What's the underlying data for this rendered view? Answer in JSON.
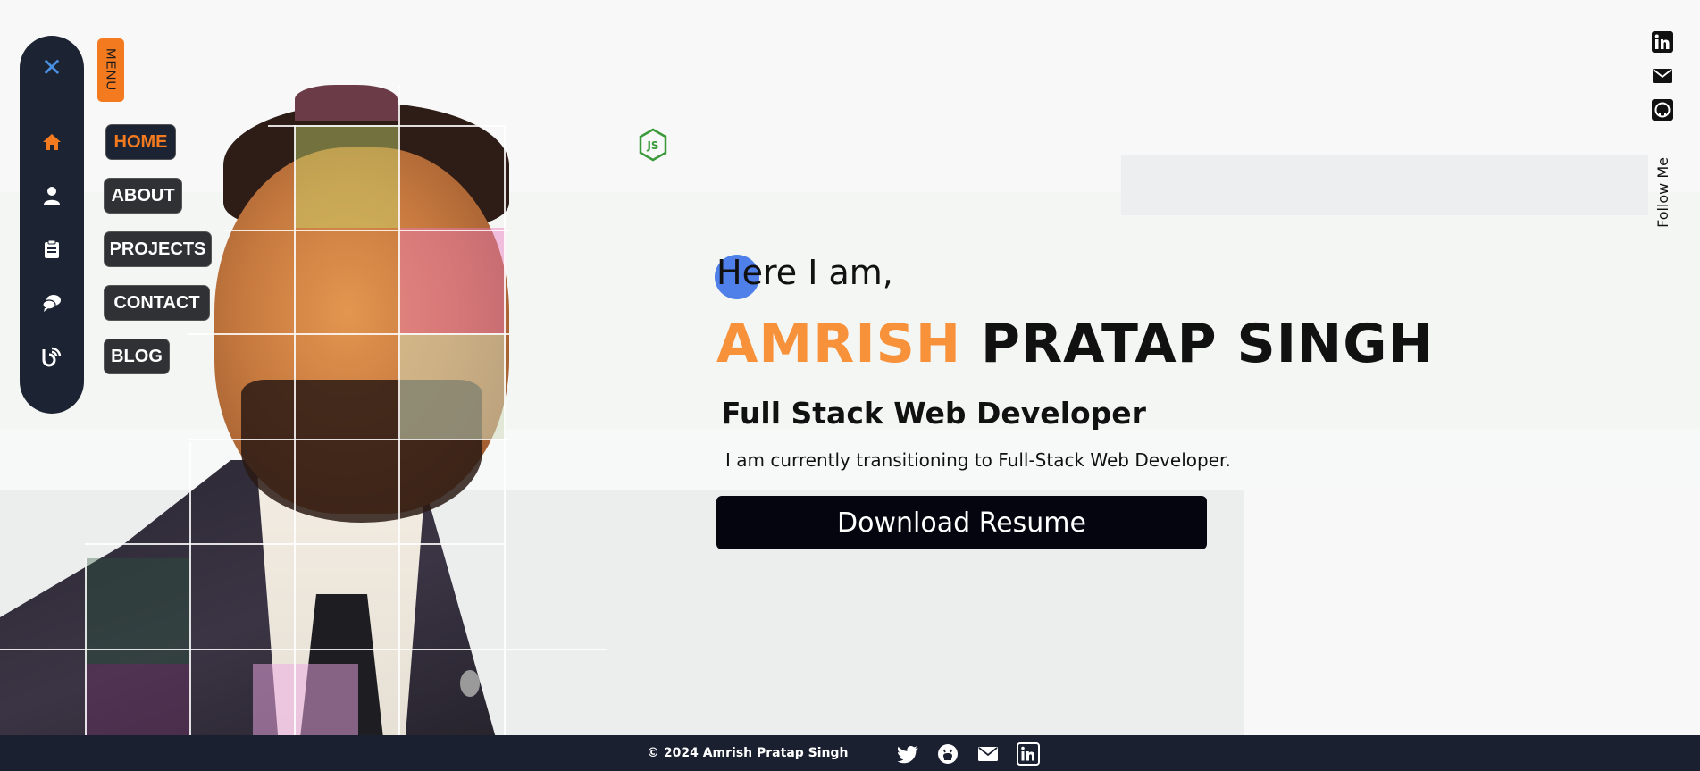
{
  "menu": {
    "close_icon": "close-icon",
    "tab_label": "MENU",
    "items": [
      {
        "label": "HOME",
        "icon": "home-icon",
        "active": true
      },
      {
        "label": "ABOUT",
        "icon": "user-icon",
        "active": false
      },
      {
        "label": "PROJECTS",
        "icon": "clipboard-icon",
        "active": false
      },
      {
        "label": "CONTACT",
        "icon": "chat-icon",
        "active": false
      },
      {
        "label": "BLOG",
        "icon": "blogger-icon",
        "active": false
      }
    ]
  },
  "hero": {
    "greeting": "Here I am,",
    "first_name": "AMRISH",
    "last_name": "PRATAP SINGH",
    "role": "Full Stack Web Developer",
    "tagline": "I am currently transitioning to Full-Stack Web Developer.",
    "cta_label": "Download Resume"
  },
  "social_right": {
    "follow_label": "Follow Me",
    "icons": [
      "linkedin-icon",
      "mail-icon",
      "github-icon"
    ]
  },
  "footer": {
    "copyright": "© 2024",
    "owner_link": "Amrish Pratap Singh",
    "icons": [
      "twitter-icon",
      "github-icon",
      "mail-icon",
      "linkedin-icon"
    ]
  },
  "colors": {
    "accent_orange": "#f47a1f",
    "nav_dark": "#1c2434",
    "footer_dark": "#1a2030",
    "button_dark": "#050510",
    "blob_blue": "#4f7fe8"
  }
}
